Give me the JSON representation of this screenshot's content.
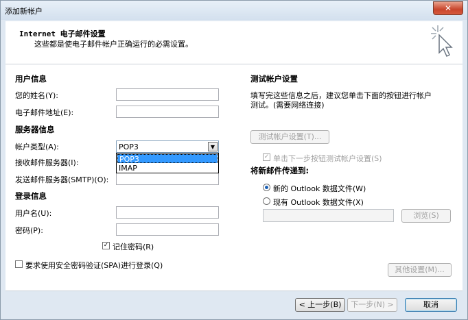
{
  "window": {
    "title": "添加新帐户",
    "close_glyph": "✕"
  },
  "header": {
    "title": "Internet 电子邮件设置",
    "subtitle": "这些都是使电子邮件帐户正确运行的必需设置。",
    "wand_icon": "magic-wand-cursor-icon"
  },
  "left": {
    "user_info": {
      "heading": "用户信息",
      "name_label": "您的姓名(Y):",
      "name_value": "",
      "email_label": "电子邮件地址(E):",
      "email_value": ""
    },
    "server_info": {
      "heading": "服务器信息",
      "account_type_label": "帐户类型(A):",
      "account_type_value": "POP3",
      "account_type_options": [
        "POP3",
        "IMAP"
      ],
      "incoming_label": "接收邮件服务器(I):",
      "incoming_value": "",
      "outgoing_label": "发送邮件服务器(SMTP)(O):",
      "outgoing_value": ""
    },
    "login_info": {
      "heading": "登录信息",
      "username_label": "用户名(U):",
      "username_value": "",
      "password_label": "密码(P):",
      "password_value": "",
      "remember_label": "记住密码(R)",
      "remember_checked": true,
      "spa_label": "要求使用安全密码验证(SPA)进行登录(Q)",
      "spa_checked": false
    }
  },
  "right": {
    "test": {
      "heading": "测试帐户设置",
      "description_line1": "填写完这些信息之后，建议您单击下面的按钮进行帐户",
      "description_line2": "测试。(需要网络连接)",
      "test_button": "测试帐户设置(T)...",
      "auto_test_label": "单击下一步按钮测试帐户设置(S)",
      "auto_test_checked": true
    },
    "deliver": {
      "heading": "将新邮件传递到:",
      "new_pst_label": "新的 Outlook 数据文件(W)",
      "existing_pst_label": "现有 Outlook 数据文件(X)",
      "selected": "new",
      "path_value": "",
      "browse_button": "浏览(S)"
    },
    "more_settings_button": "其他设置(M)..."
  },
  "footer": {
    "back_button": "< 上一步(B)",
    "next_button": "下一步(N) >",
    "cancel_button": "取消"
  }
}
